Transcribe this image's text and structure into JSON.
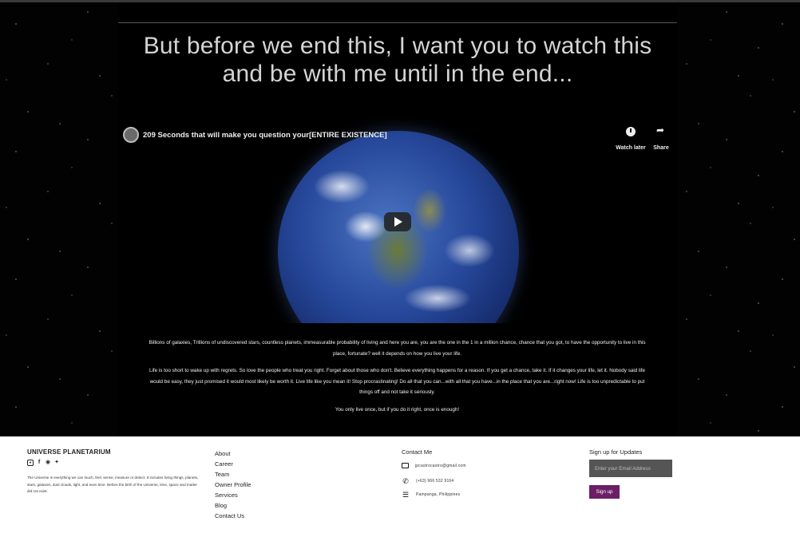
{
  "hero": {
    "heading_line1": "But before we end this, I want you to watch this",
    "heading_line2": "and be with me until in the end..."
  },
  "video": {
    "title": "209 Seconds that will make you question your[ENTIRE EXISTENCE]",
    "watch_later_label": "Watch later",
    "share_label": "Share",
    "watch_later_icon": "clock-icon",
    "share_icon": "share-arrow-icon",
    "play_icon": "play-icon"
  },
  "body": {
    "paragraph1": "Billions of galaxies, Trillions of undiscovered stars, countless planets, immeasurable probability of living and here you are, you are the one in the 1 in a million chance, chance that you got, to have the opportunity to live in this place, fortunate? well it depends on how you live your life.",
    "paragraph2": "Life is too short to wake up with regrets. So love the people who treat you right. Forget about those who don't. Believe everything happens for a reason. If you get a chance, take it. If it changes your life, let it. Nobody said life would be easy, they just promised it would most likely be worth it. Live life like you mean it! Stop procrastinating! Do all that you can...with all that you have...in the place that you are...right now! Life is too unpredictable to put things off and not take it seriously.",
    "paragraph3": "You only live once, but if you do it right, once is enough!"
  },
  "footer": {
    "brand": "UNIVERSE PLANETARIUM",
    "social_icons": [
      "instagram-icon",
      "facebook-icon",
      "github-icon",
      "twitter-icon"
    ],
    "about": "The Universe is everything we can touch, feel, sense, measure or detect. It includes living things, planets, stars, galaxies, dust clouds, light, and even time. Before the birth of the Universe, time, space and matter did not exist.",
    "links": [
      "About",
      "Career",
      "Team",
      "Owner Profile",
      "Services",
      "Blog",
      "Contact Us"
    ],
    "contact_title": "Contact Me",
    "contact_email": "jpcastrocastro@gmail.com",
    "contact_phone": "(+63) 966 532 9164",
    "contact_address": "Pampanga, Philippines",
    "signup_title": "Sign up for Updates",
    "email_placeholder": "Enter your Email Address",
    "signup_button": "Sign up"
  }
}
